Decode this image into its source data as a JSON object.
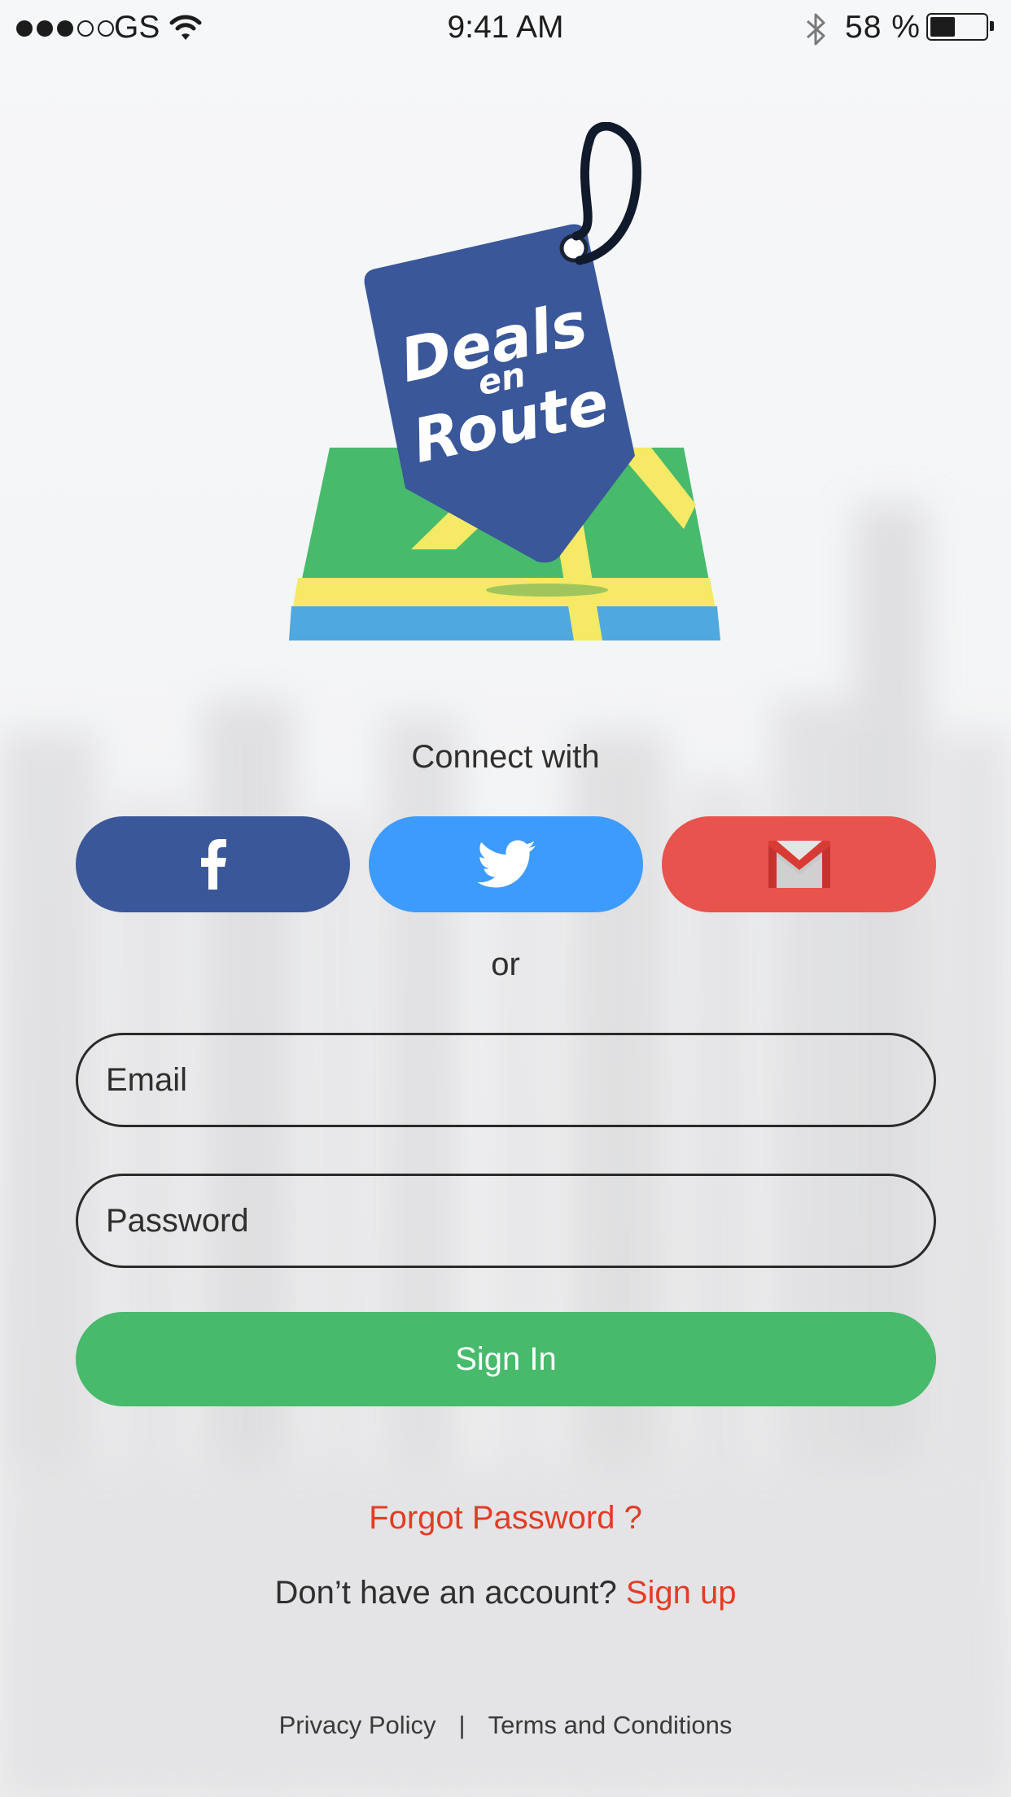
{
  "status_bar": {
    "carrier": "GS",
    "time": "9:41 AM",
    "battery_percent": "58 %",
    "battery_level": 0.5,
    "signal_bars_filled": 3,
    "signal_bars_total": 5
  },
  "logo": {
    "line1": "Deals",
    "line2": "en",
    "line3": "Route"
  },
  "connect": {
    "label": "Connect with",
    "buttons": [
      {
        "icon": "facebook-icon",
        "color": "#3a579a"
      },
      {
        "icon": "twitter-icon",
        "color": "#3d9bfd"
      },
      {
        "icon": "gmail-icon",
        "color": "#e8534e"
      }
    ]
  },
  "divider_text": "or",
  "form": {
    "email_placeholder": "Email",
    "password_placeholder": "Password",
    "sign_in_label": "Sign In"
  },
  "links": {
    "forgot_password": "Forgot Password ?",
    "no_account_prefix": "Don’t have an account? ",
    "sign_up": "Sign up"
  },
  "footer": {
    "privacy": "Privacy Policy",
    "separator": "|",
    "terms": "Terms and Conditions"
  },
  "colors": {
    "accent_green": "#47ba6c",
    "link_red": "#e43c25",
    "brand_blue": "#3a579a"
  }
}
